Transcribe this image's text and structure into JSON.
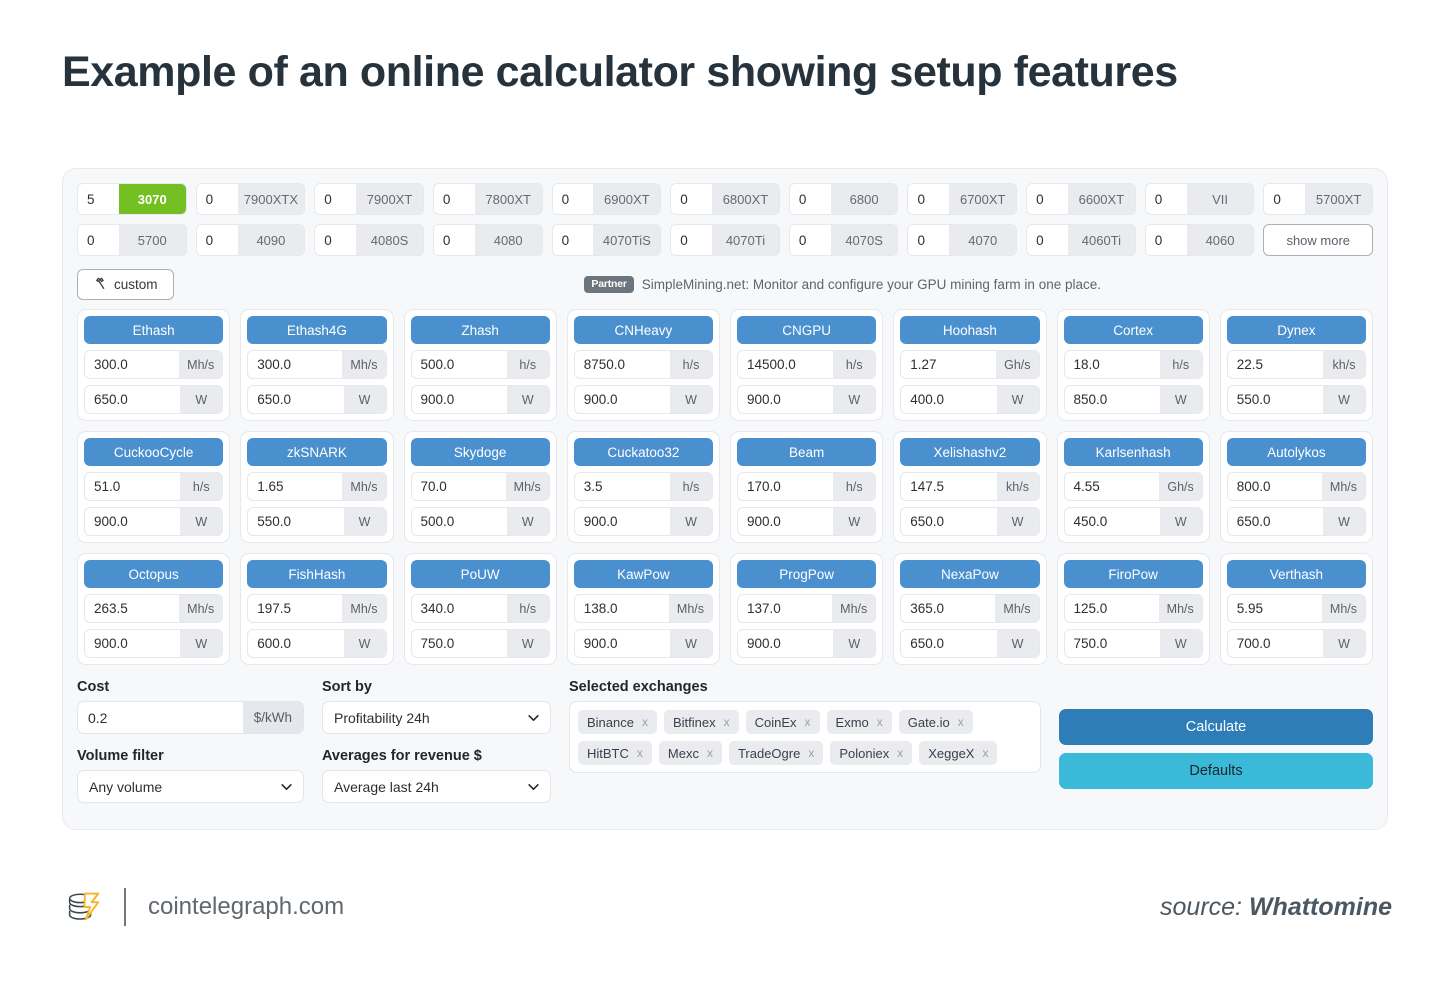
{
  "title": "Example of an online calculator showing setup features",
  "gpu_rows": [
    [
      {
        "qty": "5",
        "name": "3070",
        "selected": true
      },
      {
        "qty": "0",
        "name": "7900XTX",
        "selected": false
      },
      {
        "qty": "0",
        "name": "7900XT",
        "selected": false
      },
      {
        "qty": "0",
        "name": "7800XT",
        "selected": false
      },
      {
        "qty": "0",
        "name": "6900XT",
        "selected": false
      },
      {
        "qty": "0",
        "name": "6800XT",
        "selected": false
      },
      {
        "qty": "0",
        "name": "6800",
        "selected": false
      },
      {
        "qty": "0",
        "name": "6700XT",
        "selected": false
      },
      {
        "qty": "0",
        "name": "6600XT",
        "selected": false
      },
      {
        "qty": "0",
        "name": "VII",
        "selected": false
      },
      {
        "qty": "0",
        "name": "5700XT",
        "selected": false
      }
    ],
    [
      {
        "qty": "0",
        "name": "5700",
        "selected": false
      },
      {
        "qty": "0",
        "name": "4090",
        "selected": false
      },
      {
        "qty": "0",
        "name": "4080S",
        "selected": false
      },
      {
        "qty": "0",
        "name": "4080",
        "selected": false
      },
      {
        "qty": "0",
        "name": "4070TiS",
        "selected": false
      },
      {
        "qty": "0",
        "name": "4070Ti",
        "selected": false
      },
      {
        "qty": "0",
        "name": "4070S",
        "selected": false
      },
      {
        "qty": "0",
        "name": "4070",
        "selected": false
      },
      {
        "qty": "0",
        "name": "4060Ti",
        "selected": false
      },
      {
        "qty": "0",
        "name": "4060",
        "selected": false
      }
    ]
  ],
  "show_more_label": "show more",
  "custom_button_label": "custom",
  "partner": {
    "badge": "Partner",
    "text": "SimpleMining.net: Monitor and configure your GPU mining farm in one place."
  },
  "algorithms": [
    {
      "name": "Ethash",
      "rate": "300.0",
      "rate_unit": "Mh/s",
      "power": "650.0",
      "power_unit": "W"
    },
    {
      "name": "Ethash4G",
      "rate": "300.0",
      "rate_unit": "Mh/s",
      "power": "650.0",
      "power_unit": "W"
    },
    {
      "name": "Zhash",
      "rate": "500.0",
      "rate_unit": "h/s",
      "power": "900.0",
      "power_unit": "W"
    },
    {
      "name": "CNHeavy",
      "rate": "8750.0",
      "rate_unit": "h/s",
      "power": "900.0",
      "power_unit": "W"
    },
    {
      "name": "CNGPU",
      "rate": "14500.0",
      "rate_unit": "h/s",
      "power": "900.0",
      "power_unit": "W"
    },
    {
      "name": "Hoohash",
      "rate": "1.27",
      "rate_unit": "Gh/s",
      "power": "400.0",
      "power_unit": "W"
    },
    {
      "name": "Cortex",
      "rate": "18.0",
      "rate_unit": "h/s",
      "power": "850.0",
      "power_unit": "W"
    },
    {
      "name": "Dynex",
      "rate": "22.5",
      "rate_unit": "kh/s",
      "power": "550.0",
      "power_unit": "W"
    },
    {
      "name": "CuckooCycle",
      "rate": "51.0",
      "rate_unit": "h/s",
      "power": "900.0",
      "power_unit": "W"
    },
    {
      "name": "zkSNARK",
      "rate": "1.65",
      "rate_unit": "Mh/s",
      "power": "550.0",
      "power_unit": "W"
    },
    {
      "name": "Skydoge",
      "rate": "70.0",
      "rate_unit": "Mh/s",
      "power": "500.0",
      "power_unit": "W"
    },
    {
      "name": "Cuckatoo32",
      "rate": "3.5",
      "rate_unit": "h/s",
      "power": "900.0",
      "power_unit": "W"
    },
    {
      "name": "Beam",
      "rate": "170.0",
      "rate_unit": "h/s",
      "power": "900.0",
      "power_unit": "W"
    },
    {
      "name": "Xelishashv2",
      "rate": "147.5",
      "rate_unit": "kh/s",
      "power": "650.0",
      "power_unit": "W"
    },
    {
      "name": "Karlsenhash",
      "rate": "4.55",
      "rate_unit": "Gh/s",
      "power": "450.0",
      "power_unit": "W"
    },
    {
      "name": "Autolykos",
      "rate": "800.0",
      "rate_unit": "Mh/s",
      "power": "650.0",
      "power_unit": "W"
    },
    {
      "name": "Octopus",
      "rate": "263.5",
      "rate_unit": "Mh/s",
      "power": "900.0",
      "power_unit": "W"
    },
    {
      "name": "FishHash",
      "rate": "197.5",
      "rate_unit": "Mh/s",
      "power": "600.0",
      "power_unit": "W"
    },
    {
      "name": "PoUW",
      "rate": "340.0",
      "rate_unit": "h/s",
      "power": "750.0",
      "power_unit": "W"
    },
    {
      "name": "KawPow",
      "rate": "138.0",
      "rate_unit": "Mh/s",
      "power": "900.0",
      "power_unit": "W"
    },
    {
      "name": "ProgPow",
      "rate": "137.0",
      "rate_unit": "Mh/s",
      "power": "900.0",
      "power_unit": "W"
    },
    {
      "name": "NexaPow",
      "rate": "365.0",
      "rate_unit": "Mh/s",
      "power": "650.0",
      "power_unit": "W"
    },
    {
      "name": "FiroPow",
      "rate": "125.0",
      "rate_unit": "Mh/s",
      "power": "750.0",
      "power_unit": "W"
    },
    {
      "name": "Verthash",
      "rate": "5.95",
      "rate_unit": "Mh/s",
      "power": "700.0",
      "power_unit": "W"
    }
  ],
  "controls": {
    "cost_label": "Cost",
    "cost_value": "0.2",
    "cost_unit": "$/kWh",
    "volume_filter_label": "Volume filter",
    "volume_filter_value": "Any volume",
    "sort_by_label": "Sort by",
    "sort_by_value": "Profitability 24h",
    "averages_label": "Averages for revenue $",
    "averages_value": "Average last 24h",
    "exchanges_label": "Selected exchanges",
    "exchanges": [
      "Binance",
      "Bitfinex",
      "CoinEx",
      "Exmo",
      "Gate.io",
      "HitBTC",
      "Mexc",
      "TradeOgre",
      "Poloniex",
      "XeggeX"
    ],
    "remove_glyph": "x",
    "calculate_label": "Calculate",
    "defaults_label": "Defaults"
  },
  "footer": {
    "site": "cointelegraph.com",
    "source_prefix": "source: ",
    "source_name": "Whattomine"
  },
  "colors": {
    "accent_blue": "#4a90cf",
    "calc_blue": "#2e7cb8",
    "defaults_cyan": "#3ab9d8",
    "selected_green": "#74c023",
    "title_dark": "#26333c"
  }
}
